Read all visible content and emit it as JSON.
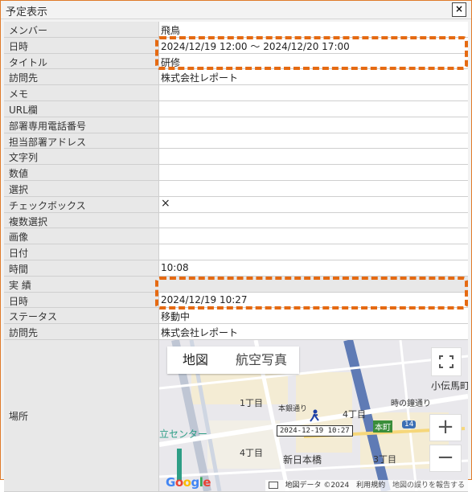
{
  "window": {
    "title": "予定表示",
    "close_icon": "×"
  },
  "rows_top": [
    {
      "label": "メンバー",
      "value": "飛鳥"
    },
    {
      "label": "日時",
      "value": "2024/12/19 12:00 ～ 2024/12/20 17:00"
    },
    {
      "label": "タイトル",
      "value": "研修"
    },
    {
      "label": "訪問先",
      "value": "株式会社レポート"
    },
    {
      "label": "メモ",
      "value": ""
    },
    {
      "label": "URL欄",
      "value": ""
    },
    {
      "label": "部署専用電話番号",
      "value": ""
    },
    {
      "label": "担当部署アドレス",
      "value": ""
    },
    {
      "label": "文字列",
      "value": ""
    },
    {
      "label": "数値",
      "value": ""
    },
    {
      "label": "選択",
      "value": ""
    },
    {
      "label": "チェックボックス",
      "value": "×"
    },
    {
      "label": "複数選択",
      "value": ""
    },
    {
      "label": "画像",
      "value": ""
    },
    {
      "label": "日付",
      "value": ""
    },
    {
      "label": "時間",
      "value": "10:08"
    }
  ],
  "section_results": "実 績",
  "rows_results": [
    {
      "label": "日時",
      "value": "2024/12/19 10:27"
    },
    {
      "label": "ステータス",
      "value": "移動中"
    },
    {
      "label": "訪問先",
      "value": "株式会社レポート"
    }
  ],
  "map_row": {
    "label": "場所"
  },
  "map": {
    "tabs": [
      "地図",
      "航空写真"
    ],
    "marker_label": "2024-12-19 10:27",
    "places": [
      "1丁目",
      "4丁目",
      "4丁目",
      "3丁目",
      "小伝馬町",
      "本町",
      "新日本橋",
      "時の鐘通り",
      "本銀通り",
      "立センター",
      "14"
    ],
    "attribution": [
      "地図データ ©2024",
      "利用規約",
      "地図の誤りを報告する"
    ],
    "logo": "Google",
    "zoom_in": "+",
    "zoom_out": "−"
  },
  "colors": {
    "highlight": "#e56a12",
    "label_bg": "#e8e8e8",
    "frame_border": "#e07b2a"
  }
}
